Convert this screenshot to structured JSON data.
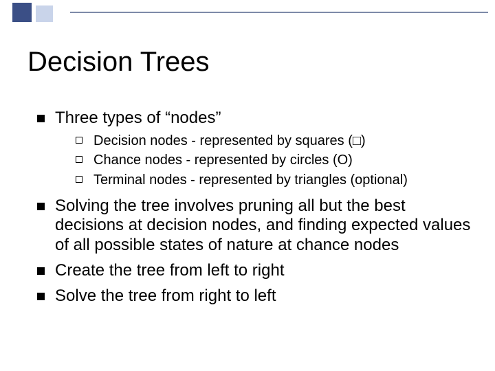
{
  "title": "Decision Trees",
  "bullets": {
    "b1": "Three types of “nodes”",
    "sub": {
      "s1": "Decision nodes - represented by squares (□)",
      "s2": "Chance nodes - represented by circles (Ο)",
      "s3": "Terminal nodes - represented by triangles  (optional)"
    },
    "b2": "Solving the tree involves pruning all but the best decisions at decision nodes, and finding expected values of all possible states of nature at chance nodes",
    "b3": "Create the tree from left to right",
    "b4": "Solve the tree from right to left"
  }
}
